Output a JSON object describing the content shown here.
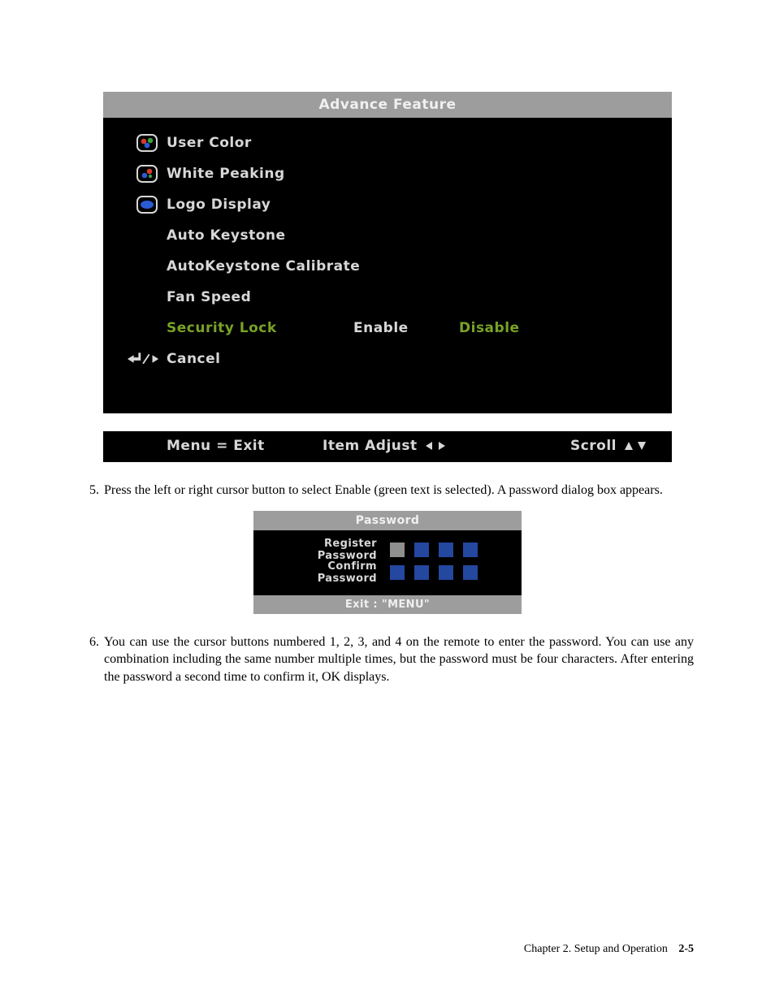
{
  "osd1": {
    "title": "Advance Feature",
    "items": [
      {
        "label": "User Color"
      },
      {
        "label": "White Peaking"
      },
      {
        "label": "Logo Display"
      },
      {
        "label": "Auto Keystone"
      },
      {
        "label": "AutoKeystone Calibrate"
      },
      {
        "label": "Fan Speed"
      }
    ],
    "security_label": "Security Lock",
    "security_enable": "Enable",
    "security_disable": "Disable",
    "cancel_label": "Cancel",
    "footer_menu": "Menu = Exit",
    "footer_adjust": "Item Adjust",
    "footer_scroll": "Scroll"
  },
  "steps": {
    "s5_num": "5.",
    "s5_text": "Press the left or right cursor button to select Enable (green text is selected). A password dialog box appears.",
    "s6_num": "6.",
    "s6_text": "You can use the cursor buttons numbered 1, 2, 3, and 4 on the remote to enter the password. You can use any combination including the same number multiple times, but the password must be four characters. After entering the password a second time to confirm it, OK displays."
  },
  "osd2": {
    "title": "Password",
    "register": "Register Password",
    "confirm": "Confirm Password",
    "exit": "Exit : \"MENU\"",
    "box_colors": {
      "first": "#8f8f8f",
      "rest": "#2447a0"
    }
  },
  "pagefoot": {
    "chapter": "Chapter 2. Setup and Operation",
    "page": "2-5"
  }
}
